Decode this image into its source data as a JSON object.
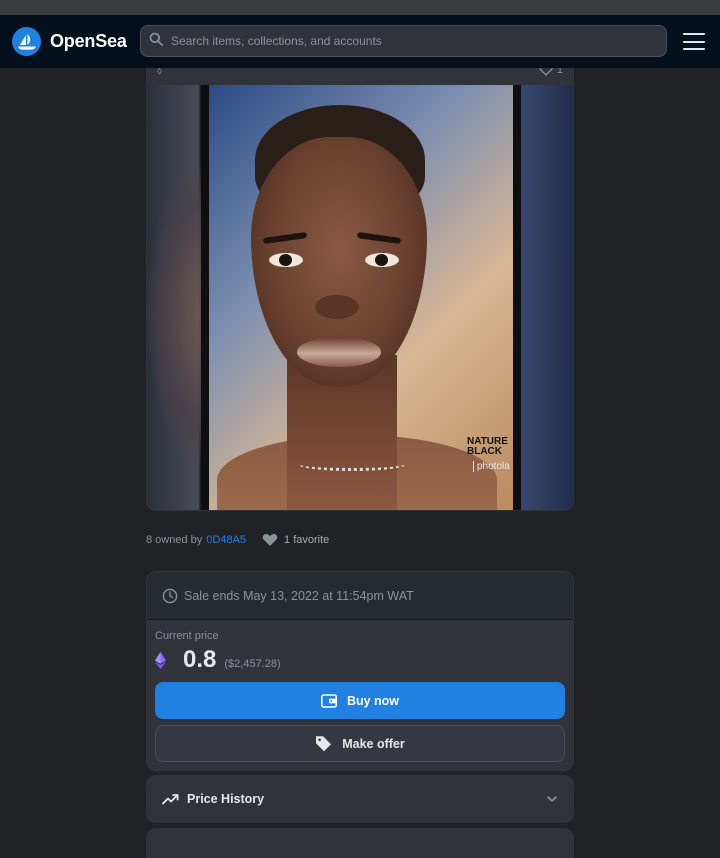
{
  "brand": {
    "name": "OpenSea",
    "color": "#2081e2"
  },
  "search": {
    "placeholder": "Search items, collections, and accounts",
    "icon": "search-icon"
  },
  "menu": {
    "icon": "hamburger-menu-icon"
  },
  "media": {
    "favorites_count": "1"
  },
  "ownership": {
    "owned_prefix": "8 owned by",
    "owner_address": "0D48A5",
    "favorites_label": "1 favorite"
  },
  "sale": {
    "ends_text": "Sale ends May 13, 2022 at 11:54pm WAT",
    "current_price_label": "Current price",
    "price_eth": "0.8",
    "price_usd": "($2,457.28)",
    "buy_label": "Buy now",
    "offer_label": "Make offer"
  },
  "price_history": {
    "title": "Price History"
  },
  "colors": {
    "background": "#202225",
    "card": "#303339",
    "navbar": "#04111d",
    "accent": "#2081e2",
    "eth_purple": "#7b5cf0"
  }
}
